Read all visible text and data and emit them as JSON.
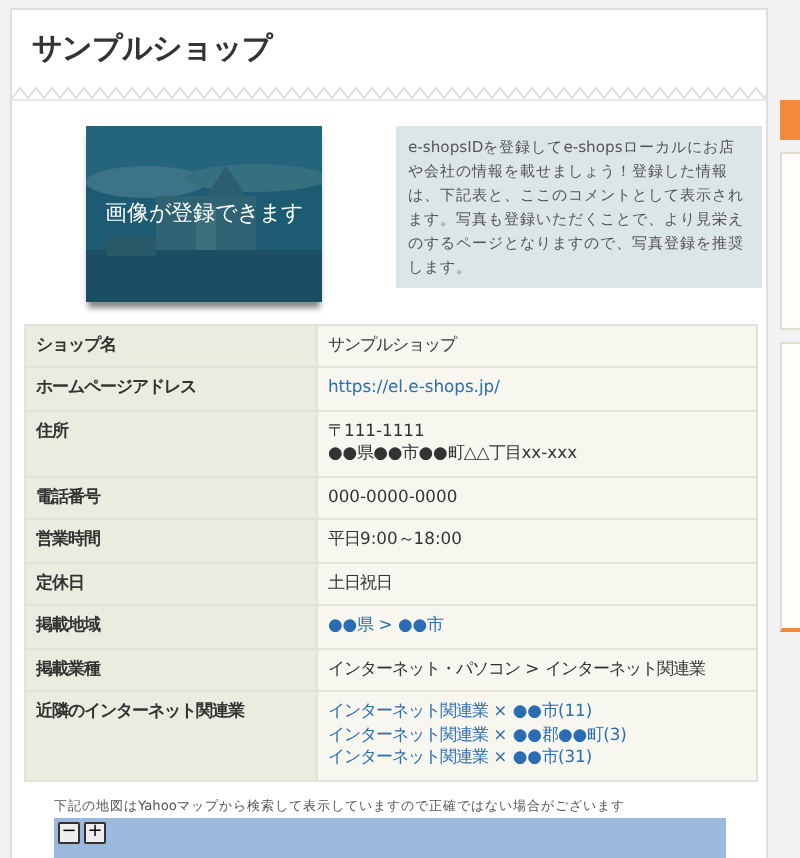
{
  "shop_title": "サンプルショップ",
  "image_placeholder": {
    "kind": "picture",
    "caption": "画像が登録できます"
  },
  "comment": "e-shopsIDを登録してe-shopsローカルにお店や会社の情報を載せましょう！登録した情報は、下記表と、ここのコメントとして表示されます。写真も登録いただくことで、より見栄えのするページとなりますので、写真登録を推奨します。",
  "table": {
    "rows": [
      {
        "label": "ショップ名",
        "values": [
          {
            "text": "サンプルショップ",
            "kind": "text"
          }
        ]
      },
      {
        "label": "ホームページアドレス",
        "values": [
          {
            "text": "https://el.e-shops.jp/",
            "kind": "link"
          }
        ]
      },
      {
        "label": "住所",
        "values": [
          {
            "text": "〒111-1111",
            "kind": "text"
          },
          {
            "text": "●●県●●市●●町△△丁目xx-xxx",
            "kind": "text"
          }
        ]
      },
      {
        "label": "電話番号",
        "values": [
          {
            "text": "000-0000-0000",
            "kind": "text"
          }
        ]
      },
      {
        "label": "営業時間",
        "values": [
          {
            "text": "平日9:00～18:00",
            "kind": "text"
          }
        ]
      },
      {
        "label": "定休日",
        "values": [
          {
            "text": "土日祝日",
            "kind": "text"
          }
        ]
      },
      {
        "label": "掲載地域",
        "values": [
          {
            "text": "●●県 > ●●市",
            "kind": "link"
          }
        ]
      },
      {
        "label": "掲載業種",
        "values": [
          {
            "text": "インターネット・パソコン > インターネット関連業",
            "kind": "text"
          }
        ]
      },
      {
        "label": "近隣のインターネット関連業",
        "values": [
          {
            "text": "インターネット関連業 × ●●市(11)",
            "kind": "link"
          },
          {
            "text": "インターネット関連業 × ●●郡●●町(3)",
            "kind": "link"
          },
          {
            "text": "インターネット関連業 × ●●市(31)",
            "kind": "link"
          }
        ]
      }
    ]
  },
  "map": {
    "note": "下記の地図はYahooマップから検索して表示していますので正確ではない場合がございます",
    "zoom_buttons": [
      "−",
      "+"
    ]
  }
}
